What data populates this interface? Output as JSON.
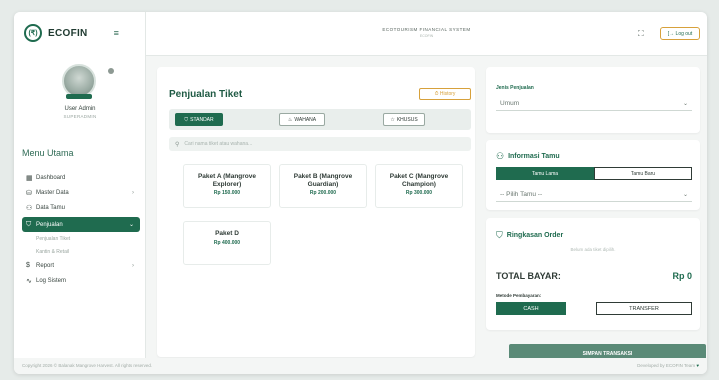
{
  "app": {
    "brand": "ECOFIN",
    "logo_glyph": "(₹)",
    "header_title": "ECOTOURISM FINANCIAL SYSTEM",
    "header_subtitle": "ECOFIN",
    "logout_label": "[→ Log out",
    "fullscreen_icon": "⛶"
  },
  "user": {
    "name": "User Admin",
    "role": "SUPERADMIN"
  },
  "sidebar": {
    "menu_title": "Menu Utama",
    "items": [
      {
        "label": "Dashboard",
        "icon": "▦",
        "chev": ""
      },
      {
        "label": "Master Data",
        "icon": "⛁",
        "chev": "›"
      },
      {
        "label": "Data Tamu",
        "icon": "⚇",
        "chev": ""
      },
      {
        "label": "Penjualan",
        "icon": "⛉",
        "chev": "⌄"
      },
      {
        "label": "Penjualan Tiket",
        "sub": true
      },
      {
        "label": "Kantin & Retail",
        "sub": true
      },
      {
        "label": "Report",
        "icon": "$",
        "chev": "›"
      },
      {
        "label": "Log Sistem",
        "icon": "∿",
        "chev": ""
      }
    ]
  },
  "main": {
    "title": "Penjualan Tiket",
    "history_label": "⏱ History",
    "tabs": [
      {
        "label": "STANDAR",
        "icon": "⛉"
      },
      {
        "label": "WAHANA",
        "icon": "♨"
      },
      {
        "label": "KHUSUS",
        "icon": "☆"
      }
    ],
    "search_placeholder": "Cari nama tiket atau wahana...",
    "search_icon": "⚲",
    "packages": [
      {
        "name": "Paket A (Mangrove Explorer)",
        "price": "Rp 150.000"
      },
      {
        "name": "Paket B (Mangrove Guardian)",
        "price": "Rp 200.000"
      },
      {
        "name": "Paket C (Mangrove Champion)",
        "price": "Rp 300.000"
      },
      {
        "name": "Paket D",
        "price": "Rp 400.000"
      }
    ]
  },
  "right": {
    "jenis_label": "Jenis Penjualan",
    "jenis_value": "Umum",
    "tamu_title": "Informasi Tamu",
    "tamu_icon": "⚇",
    "tamu_tabs": [
      "Tamu Lama",
      "Tamu Baru"
    ],
    "tamu_select": "-- Pilih Tamu --",
    "order_title": "Ringkasan Order",
    "order_icon": "⛉",
    "order_empty": "Belum ada tiket dipilih.",
    "total_label": "TOTAL BAYAR:",
    "total_value": "Rp 0",
    "payment_label": "Metode Pembayaran:",
    "payment_options": [
      "CASH",
      "TRANSFER"
    ],
    "save_label": "SIMPAN TRANSAKSI",
    "chev": "⌄"
  },
  "footer": {
    "left": "Copyright 2026 © Balanak Mangrove Harvest. All rights reserved.",
    "right": "Developed by ECOFIN Team",
    "heart": "♥"
  },
  "colors": {
    "primary": "#1f6b4f",
    "accent": "#d7a13b",
    "save_button": "#5a8a77"
  }
}
